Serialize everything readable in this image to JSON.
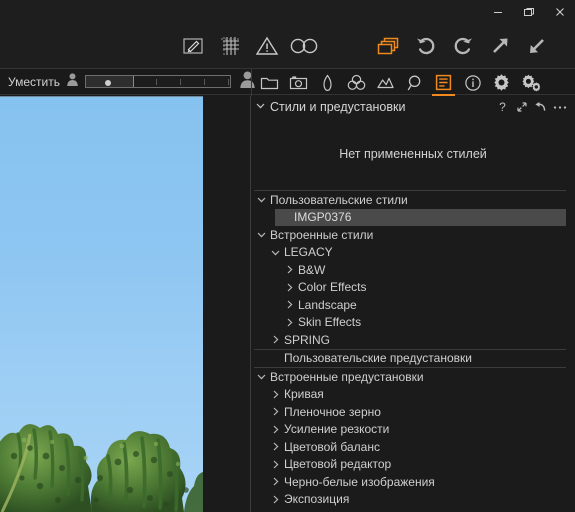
{
  "window": {
    "controls": [
      {
        "name": "minimize",
        "glyph": "minimize-icon"
      },
      {
        "name": "restore",
        "glyph": "restore-icon"
      },
      {
        "name": "close",
        "glyph": "close-icon"
      }
    ]
  },
  "toolbar_top": {
    "left_group": [
      {
        "name": "draw-mask-icon",
        "title": "Draw mask"
      },
      {
        "name": "grid-overlay-icon",
        "title": "Grid overlay"
      },
      {
        "name": "clipping-warning-icon",
        "title": "Clipping warning"
      },
      {
        "name": "focus-mask-icon",
        "title": "Focus mask"
      }
    ],
    "right_group": [
      {
        "name": "copy-layers-icon",
        "title": "Variants",
        "accent": true
      },
      {
        "name": "undo-icon",
        "title": "Undo"
      },
      {
        "name": "redo-icon",
        "title": "Redo"
      },
      {
        "name": "expand-arrow-icon",
        "title": "Expand"
      },
      {
        "name": "collapse-arrow-icon",
        "title": "Collapse"
      }
    ]
  },
  "toolbar_sub": {
    "fit_label": "Уместить",
    "zoom_value": 33,
    "tabs": [
      {
        "name": "library-folder-icon",
        "title": "Library",
        "active": false
      },
      {
        "name": "camera-capture-icon",
        "title": "Capture",
        "active": false
      },
      {
        "name": "lens-correction-icon",
        "title": "Lens",
        "active": false
      },
      {
        "name": "color-wheels-icon",
        "title": "Color",
        "active": false
      },
      {
        "name": "exposure-icon",
        "title": "Exposure",
        "active": false
      },
      {
        "name": "details-loupe-icon",
        "title": "Details",
        "active": false
      },
      {
        "name": "adjustments-list-icon",
        "title": "Styles and presets",
        "active": true
      },
      {
        "name": "metadata-info-icon",
        "title": "Metadata",
        "active": false
      },
      {
        "name": "output-gear-icon",
        "title": "Output",
        "active": false
      },
      {
        "name": "batch-gears-icon",
        "title": "Batch",
        "active": false
      }
    ]
  },
  "panel": {
    "title": "Стили и предустановки",
    "collapse_chevron": "chevron-down-icon",
    "actions": [
      {
        "name": "help-icon",
        "glyph": "?"
      },
      {
        "name": "reset-arrows-icon",
        "glyph": "expand-collapse"
      },
      {
        "name": "undo-arrow-icon",
        "glyph": "undo"
      },
      {
        "name": "more-options-icon",
        "glyph": "..."
      }
    ],
    "empty_message": "Нет примененных стилей",
    "tree": [
      {
        "label": "Пользовательские стили",
        "indent": 0,
        "state": "expanded",
        "kind": "group",
        "sep_top": true
      },
      {
        "label": "IMGP0376",
        "indent": 1,
        "state": "none",
        "kind": "item",
        "selected": true
      },
      {
        "label": "Встроенные стили",
        "indent": 0,
        "state": "expanded",
        "kind": "group"
      },
      {
        "label": "LEGACY",
        "indent": 1,
        "state": "expanded",
        "kind": "group"
      },
      {
        "label": "B&W",
        "indent": 2,
        "state": "collapsed",
        "kind": "group"
      },
      {
        "label": "Color Effects",
        "indent": 2,
        "state": "collapsed",
        "kind": "group"
      },
      {
        "label": "Landscape",
        "indent": 2,
        "state": "collapsed",
        "kind": "group"
      },
      {
        "label": "Skin Effects",
        "indent": 2,
        "state": "collapsed",
        "kind": "group"
      },
      {
        "label": "SPRING",
        "indent": 1,
        "state": "collapsed",
        "kind": "group"
      },
      {
        "label": "Пользовательские предустановки",
        "indent": 1,
        "state": "none",
        "kind": "group",
        "sep_top": true,
        "sep_bot": true
      },
      {
        "label": "Встроенные предустановки",
        "indent": 0,
        "state": "expanded",
        "kind": "group"
      },
      {
        "label": "Кривая",
        "indent": 1,
        "state": "collapsed",
        "kind": "group"
      },
      {
        "label": "Пленочное зерно",
        "indent": 1,
        "state": "collapsed",
        "kind": "group"
      },
      {
        "label": "Усиление резкости",
        "indent": 1,
        "state": "collapsed",
        "kind": "group"
      },
      {
        "label": "Цветовой баланс",
        "indent": 1,
        "state": "collapsed",
        "kind": "group"
      },
      {
        "label": "Цветовой редактор",
        "indent": 1,
        "state": "collapsed",
        "kind": "group"
      },
      {
        "label": "Черно-белые изображения",
        "indent": 1,
        "state": "collapsed",
        "kind": "group"
      },
      {
        "label": "Экспозиция",
        "indent": 1,
        "state": "collapsed",
        "kind": "group"
      }
    ]
  },
  "preview": {
    "image_name": "IMGP0376",
    "description": "birch-tree-against-blue-sky",
    "sky_color": "#8ec6f2",
    "foliage_color": "#4a7a34"
  },
  "colors": {
    "accent": "#f08a1e",
    "panel_bg": "#1b1b1b",
    "toolbar_bg": "#1e1e1e",
    "selection": "#4a4a4a",
    "text": "#cfcfcf"
  }
}
